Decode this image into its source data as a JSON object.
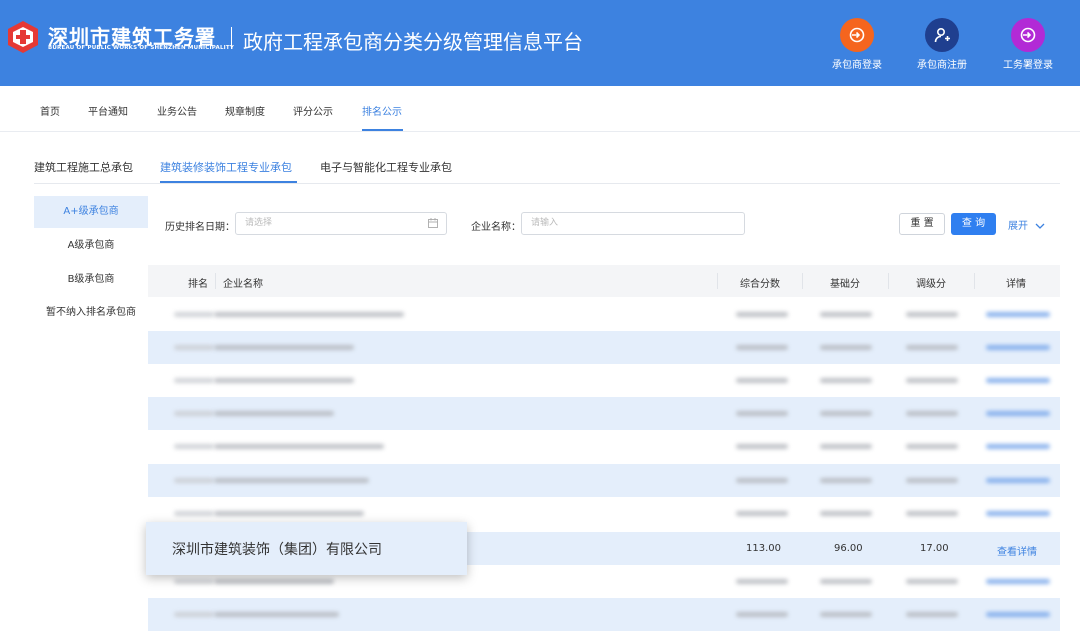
{
  "header": {
    "org_name": "深圳市建筑工务署",
    "org_name_en": "BUREAU OF PUBLIC WORKS OF SHENZHEN MUNICIPALITY",
    "platform_title": "政府工程承包商分类分级管理信息平台",
    "actions": [
      {
        "label": "承包商登录",
        "icon": "login-arrow-icon",
        "color": "#f5651e"
      },
      {
        "label": "承包商注册",
        "icon": "user-add-icon",
        "color": "#1f3f8f"
      },
      {
        "label": "工务署登录",
        "icon": "login-arrow-icon",
        "color": "#b22ad6"
      }
    ]
  },
  "nav": {
    "items": [
      "首页",
      "平台通知",
      "业务公告",
      "规章制度",
      "评分公示",
      "排名公示"
    ],
    "active": "排名公示"
  },
  "category_tabs": {
    "items": [
      "建筑工程施工总承包",
      "建筑装修装饰工程专业承包",
      "电子与智能化工程专业承包"
    ],
    "active": "建筑装修装饰工程专业承包"
  },
  "sidebar": {
    "items": [
      "A+级承包商",
      "A级承包商",
      "B级承包商",
      "暂不纳入排名承包商"
    ],
    "active": "A+级承包商"
  },
  "filters": {
    "date_label": "历史排名日期：",
    "date_placeholder": "请选择",
    "company_label": "企业名称：",
    "company_placeholder": "请输入",
    "reset_label": "重 置",
    "query_label": "查 询",
    "expand_label": "展开"
  },
  "table": {
    "columns": [
      "排名",
      "企业名称",
      "综合分数",
      "基础分",
      "调级分",
      "详情"
    ],
    "highlighted_row": {
      "row_index": 7,
      "company": "深圳市建筑装饰（集团）有限公司",
      "total_score": "113.00",
      "base_score": "96.00",
      "adjust_score": "17.00",
      "detail": "查看详情"
    }
  },
  "colors": {
    "brand_blue": "#3d82e0",
    "query_button": "#2f7ff0",
    "row_highlight": "#e4eefb"
  }
}
